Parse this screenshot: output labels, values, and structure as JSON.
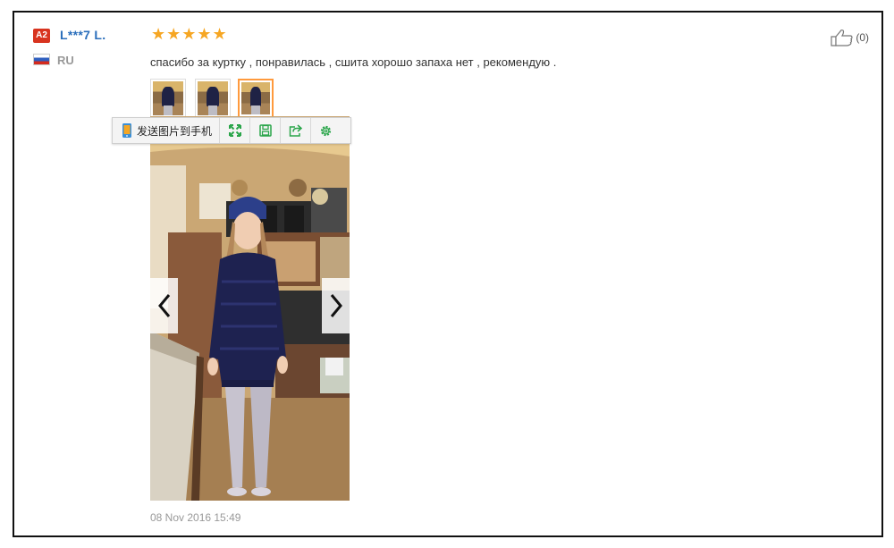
{
  "review": {
    "level_badge": "A2",
    "user_name": "L***7 L.",
    "country_code": "RU",
    "rating_stars": "★★★★★",
    "rating_value": 5,
    "rating_max": 5,
    "text": "спасибо за куртку , понравилась , сшита хорошо запаха нет , рекомендую .",
    "helpful_count": "(0)",
    "date": "08 Nov 2016 15:49",
    "thumbnails_count": 3,
    "active_thumbnail": 3
  },
  "toolbar": {
    "send_to_phone_label": "发送图片到手机",
    "buttons": [
      "fullscreen-icon",
      "save-icon",
      "share-icon",
      "settings-icon"
    ]
  },
  "colors": {
    "badge": "#d8341f",
    "user_name": "#2a6ebb",
    "stars": "#f6a623",
    "active_thumb_border": "#ff9a3d",
    "toolbar_icons": "#2aa54a"
  }
}
